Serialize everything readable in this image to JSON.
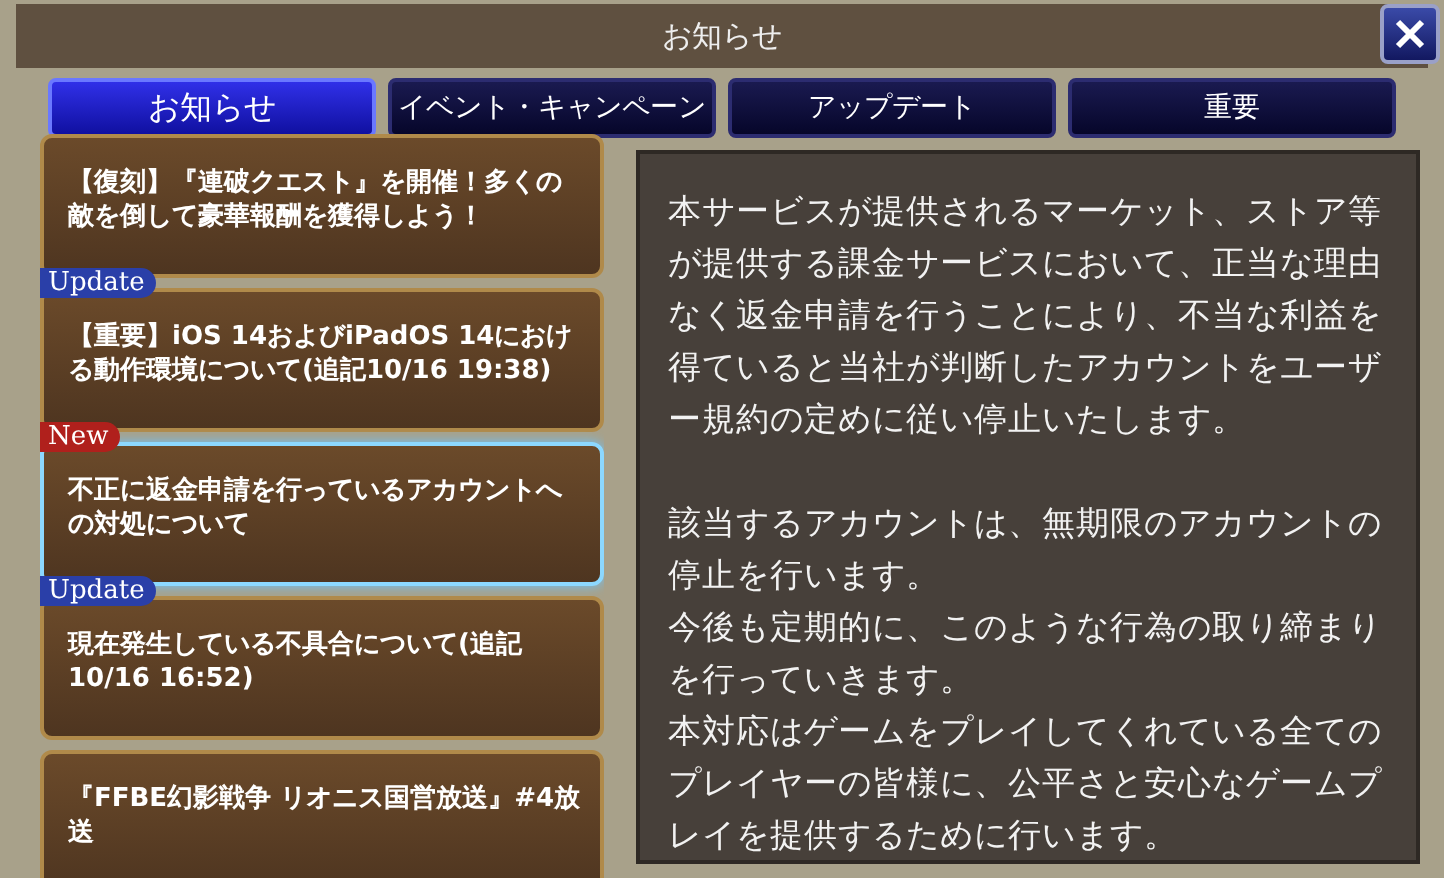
{
  "window": {
    "title": "お知らせ"
  },
  "tabs": [
    {
      "label": "お知らせ",
      "selected": true
    },
    {
      "label": "イベント・キャンペーン",
      "selected": false
    },
    {
      "label": "アップデート",
      "selected": false
    },
    {
      "label": "重要",
      "selected": false
    }
  ],
  "notices": [
    {
      "title": "【復刻】『連破クエスト』を開催！多くの敵を倒して豪華報酬を獲得しよう！",
      "selected": false
    },
    {
      "badge": {
        "kind": "update",
        "label": "Update"
      },
      "title": "【重要】iOS 14およびiPadOS 14における動作環境について(追記10/16 19:38)",
      "selected": false
    },
    {
      "badge": {
        "kind": "new",
        "label": "New"
      },
      "title": "不正に返金申請を行っているアカウントへの対処について",
      "selected": true
    },
    {
      "badge": {
        "kind": "update",
        "label": "Update"
      },
      "title": "現在発生している不具合について(追記10/16 16:52)",
      "selected": false
    },
    {
      "title": "『FFBE幻影戦争 リオニス国営放送』#4放送",
      "selected": false
    }
  ],
  "detail": {
    "paragraphs": [
      "本サービスが提供されるマーケット、ストア等が提供する課金サービスにおいて、正当な理由なく返金申請を行うことにより、不当な利益を得ていると当社が判断したアカウントをユーザー規約の定めに従い停止いたします。",
      "該当するアカウントは、無期限のアカウントの停止を行います。",
      "今後も定期的に、このような行為の取り締まりを行っていきます。",
      "本対応はゲームをプレイしてくれている全てのプレイヤーの皆様に、公平さと安心なゲームプレイを提供するために行います。"
    ]
  }
}
